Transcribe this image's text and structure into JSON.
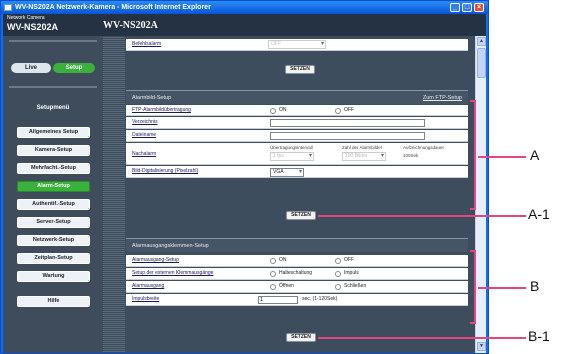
{
  "window": {
    "title": "WV-NS202A Netzwerk-Kamera - Microsoft Internet Explorer"
  },
  "header": {
    "camera_label": "Network Camera",
    "model": "WV-NS202A",
    "page_title": "WV-NS202A"
  },
  "nav": {
    "live": "Live",
    "setup": "Setup"
  },
  "menu": {
    "title": "Setupmenü",
    "items": [
      "Allgemeines Setup",
      "Kamera-Setup",
      "Mehrfacht.-Setup",
      "Alarm-Setup",
      "Authentif.-Setup",
      "Server-Setup",
      "Netzwerk-Setup",
      "Zeitplan-Setup",
      "Wartung",
      "Hilfe"
    ],
    "active_index": 3
  },
  "top": {
    "label": "Befehlsalarm",
    "value": "OFF",
    "button": "SETZEN"
  },
  "alarmbild": {
    "title": "Alarmbild-Setup",
    "link": "Zum FTP-Setup",
    "rows": {
      "ftp": "FTP-Alarmbildübertragung",
      "verzeichnis": "Verzeichnis",
      "dateiname": "Dateiname",
      "nachalarm": "Nachalarm",
      "digital": "Bild-Digitalisierung (Pixelzahl)"
    },
    "on": "ON",
    "off": "OFF",
    "col1": "Übertragungsintervall",
    "col2": "Zahl der Alarmbilder",
    "col3": "Aufzeichnungsdauer",
    "interval": "1 fps",
    "count": "100 Bilder",
    "duration": "100Sek",
    "resolution": "VGA",
    "button": "SETZEN"
  },
  "klemmen": {
    "title": "Alarmausgangsklemmen-Setup",
    "rows": {
      "setup": "Alarmausgang-Setup",
      "extern": "Setup der externen Klemmausgänge",
      "ausgang": "Alarmausgang",
      "impuls": "Impulsbreite"
    },
    "on": "ON",
    "off": "OFF",
    "halte": "Halteschaltung",
    "impulse": "Impuls",
    "offen": "Öffnen",
    "schliessen": "Schließen",
    "impuls_value": "1",
    "impuls_unit": "sec. (1-120Sek)",
    "button": "SETZEN"
  },
  "annotations": {
    "a": "A",
    "a1": "A-1",
    "b": "B",
    "b1": "B-1"
  },
  "colors": {
    "accent": "#3ab13a",
    "annotation": "#e5467f"
  }
}
